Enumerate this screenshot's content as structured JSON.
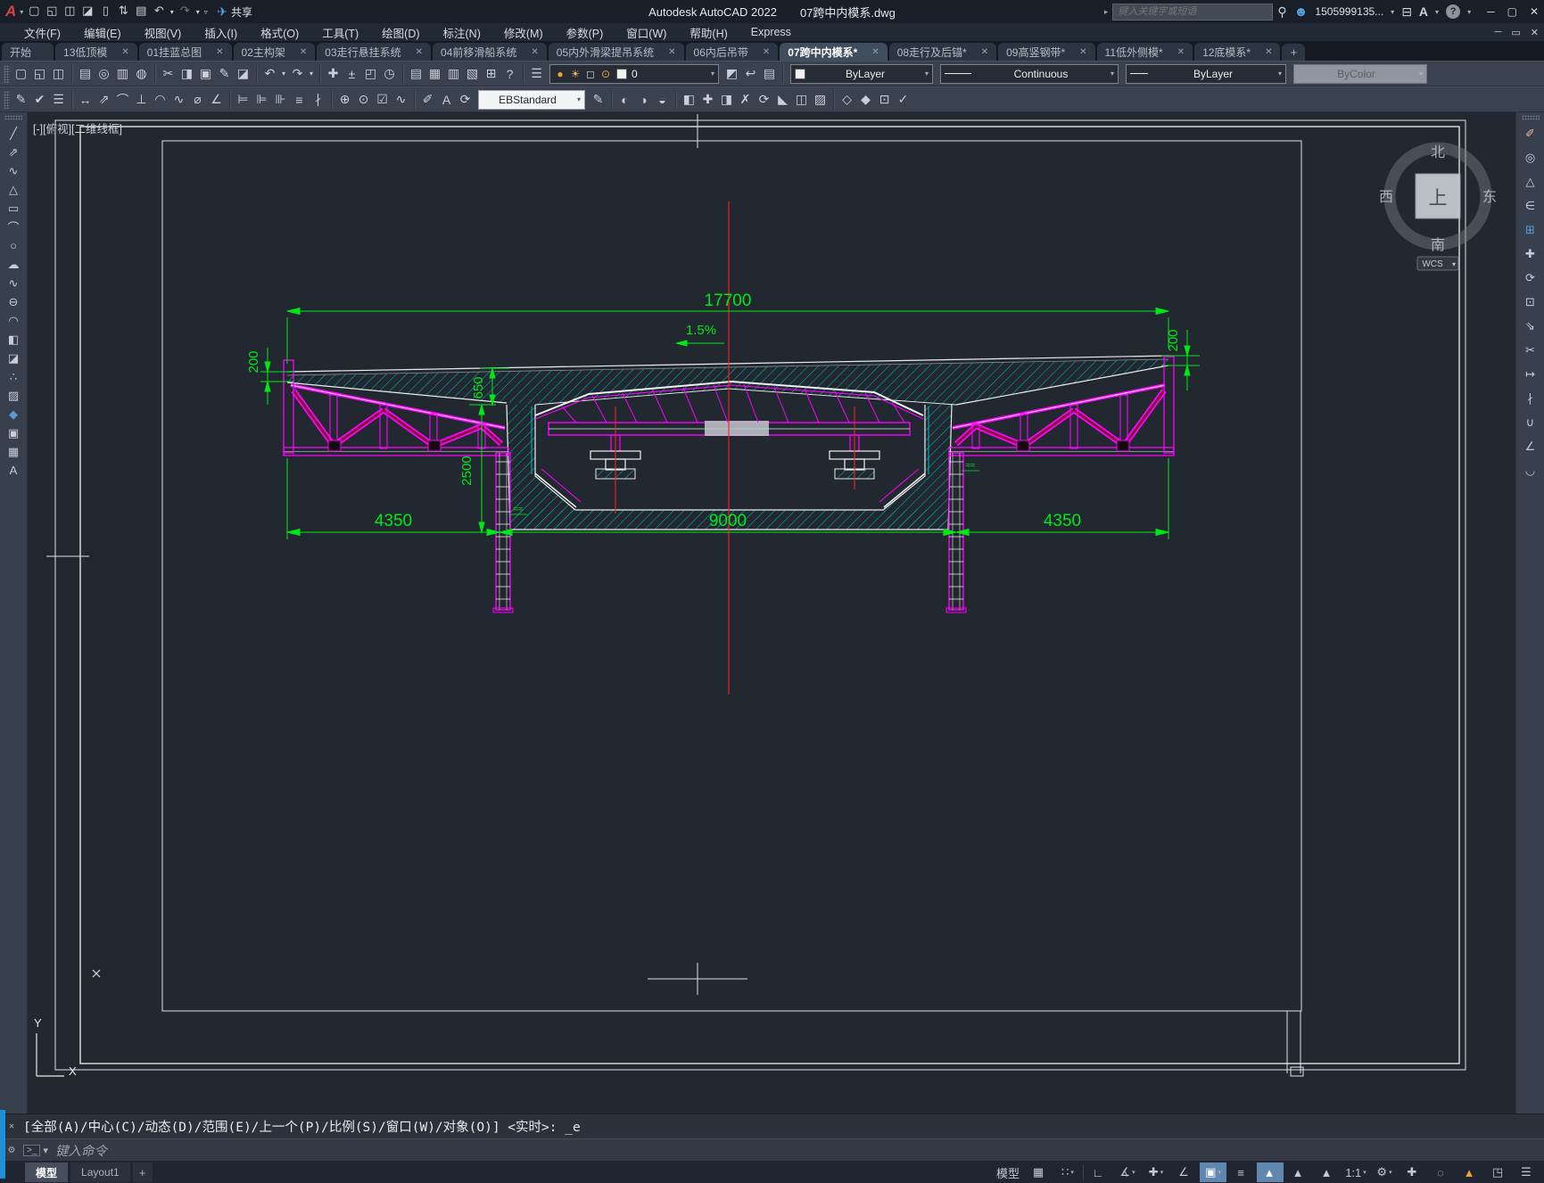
{
  "titlebar": {
    "app_title": "Autodesk AutoCAD 2022",
    "doc_title": "07跨中内模系.dwg",
    "share_label": "共享",
    "search_placeholder": "键入关键字或短语",
    "user_id": "1505999135...",
    "logo_letter": "A",
    "quick_access": [
      {
        "name": "new-file-icon",
        "g": "▢"
      },
      {
        "name": "open-file-icon",
        "g": "◱"
      },
      {
        "name": "save-icon",
        "g": "◫"
      },
      {
        "name": "save-as-icon",
        "g": "◪"
      },
      {
        "name": "save-to-mobile-icon",
        "g": "▯"
      },
      {
        "name": "open-from-mobile-icon",
        "g": "⇅"
      },
      {
        "name": "plot-icon",
        "g": "▤"
      },
      {
        "name": "undo-icon",
        "g": "↶"
      },
      {
        "name": "undo-caret-icon",
        "g": "▾",
        "small": true
      },
      {
        "name": "redo-icon",
        "g": "↷",
        "dim": true
      },
      {
        "name": "redo-caret-icon",
        "g": "▾",
        "small": true
      },
      {
        "name": "qat-customize-icon",
        "g": "▿",
        "small": true
      }
    ],
    "window_buttons": [
      {
        "name": "minimize-button",
        "g": "─"
      },
      {
        "name": "maximize-button",
        "g": "▢"
      },
      {
        "name": "close-button",
        "g": "✕"
      }
    ]
  },
  "menubar": {
    "items": [
      "文件(F)",
      "编辑(E)",
      "视图(V)",
      "插入(I)",
      "格式(O)",
      "工具(T)",
      "绘图(D)",
      "标注(N)",
      "修改(M)",
      "参数(P)",
      "窗口(W)",
      "帮助(H)",
      "Express"
    ],
    "window_buttons": [
      {
        "name": "doc-minimize-button",
        "g": "─"
      },
      {
        "name": "doc-restore-button",
        "g": "▭"
      },
      {
        "name": "doc-close-button",
        "g": "✕"
      }
    ]
  },
  "filetabs": {
    "tabs": [
      {
        "label": "开始",
        "close": ""
      },
      {
        "label": "13低顶模",
        "close": "✕"
      },
      {
        "label": "01挂蓝总图",
        "close": "✕"
      },
      {
        "label": "02主构架",
        "close": "✕"
      },
      {
        "label": "03走行悬挂系统",
        "close": "✕"
      },
      {
        "label": "04前移滑船系统",
        "close": "✕"
      },
      {
        "label": "05内外滑梁提吊系统",
        "close": "✕"
      },
      {
        "label": "06内后吊带",
        "close": "✕"
      },
      {
        "label": "07跨中内模系*",
        "close": "✕",
        "active": true
      },
      {
        "label": "08走行及后锚*",
        "close": "✕"
      },
      {
        "label": "09高竖钢带*",
        "close": "✕"
      },
      {
        "label": "11低外侧模*",
        "close": "✕"
      },
      {
        "label": "12底模系*",
        "close": "✕"
      }
    ],
    "plus_label": "+"
  },
  "toolbar1": {
    "icons": [
      {
        "name": "new-icon",
        "g": "▢"
      },
      {
        "name": "open-icon",
        "g": "◱"
      },
      {
        "name": "save-icon",
        "g": "◫"
      },
      {
        "sep": true
      },
      {
        "name": "plot-icon",
        "g": "▤"
      },
      {
        "name": "plot-preview-icon",
        "g": "◎"
      },
      {
        "name": "publish-icon",
        "g": "▥"
      },
      {
        "name": "web-icon",
        "g": "◍"
      },
      {
        "sep": true
      },
      {
        "name": "cut-icon",
        "g": "✂"
      },
      {
        "name": "copy-clip-icon",
        "g": "◨"
      },
      {
        "name": "paste-icon",
        "g": "▣"
      },
      {
        "name": "match-properties-icon",
        "g": "✎"
      },
      {
        "name": "block-editor-icon",
        "g": "◪"
      },
      {
        "sep": true
      },
      {
        "name": "undo-icon",
        "g": "↶"
      },
      {
        "name": "undo-caret-icon",
        "g": "▾",
        "small": true
      },
      {
        "name": "redo-icon",
        "g": "↷"
      },
      {
        "name": "redo-caret-icon",
        "g": "▾",
        "small": true
      },
      {
        "sep": true
      },
      {
        "name": "pan-icon",
        "g": "✚"
      },
      {
        "name": "zoom-realtime-icon",
        "g": "±"
      },
      {
        "name": "zoom-window-icon",
        "g": "◰"
      },
      {
        "name": "zoom-previous-icon",
        "g": "◷"
      },
      {
        "sep": true
      },
      {
        "name": "properties-palette-icon",
        "g": "▤"
      },
      {
        "name": "designcenter-icon",
        "g": "▦"
      },
      {
        "name": "tool-palettes-icon",
        "g": "▥"
      },
      {
        "name": "sheet-set-icon",
        "g": "▧"
      },
      {
        "name": "quickcalc-icon",
        "g": "⊞"
      },
      {
        "name": "help-icon",
        "g": "?"
      },
      {
        "sep": true
      },
      {
        "name": "layer-properties-icon",
        "g": "☰"
      }
    ],
    "layer_state_icons": [
      {
        "name": "layer-on-icon",
        "g": "●",
        "color": "#f0a23a"
      },
      {
        "name": "layer-thaw-icon",
        "g": "☀",
        "color": "#f2c24a"
      },
      {
        "name": "layer-freeze-vp-icon",
        "g": "◻",
        "color": "#c8cdd4"
      },
      {
        "name": "layer-unlock-icon",
        "g": "⊙",
        "color": "#f0a23a"
      }
    ],
    "layer_value": "0",
    "layer_tool_icons": [
      {
        "name": "make-layer-current-icon",
        "g": "◩"
      },
      {
        "name": "layer-previous-icon",
        "g": "↩"
      },
      {
        "name": "layer-states-icon",
        "g": "▤"
      }
    ],
    "color_value": "ByLayer",
    "linetype_value": "Continuous",
    "lineweight_value": "ByLayer",
    "plotstyle_value": "ByColor"
  },
  "toolbar2": {
    "icons_left": [
      {
        "name": "text-style-icon",
        "g": "✎"
      },
      {
        "name": "spell-check-icon",
        "g": "✔"
      },
      {
        "name": "styles-icon",
        "g": "☰"
      },
      {
        "sep": true
      },
      {
        "name": "dim-linear-icon",
        "g": "↔"
      },
      {
        "name": "dim-aligned-icon",
        "g": "⇗"
      },
      {
        "name": "dim-arc-icon",
        "g": "⌒"
      },
      {
        "name": "dim-ordinate-icon",
        "g": "⊥"
      },
      {
        "name": "dim-radius-icon",
        "g": "◠"
      },
      {
        "name": "dim-jogged-icon",
        "g": "∿"
      },
      {
        "name": "dim-diameter-icon",
        "g": "⌀"
      },
      {
        "name": "dim-angular-icon",
        "g": "∠"
      },
      {
        "sep": true
      },
      {
        "name": "quick-dim-icon",
        "g": "⊨"
      },
      {
        "name": "dim-baseline-icon",
        "g": "⊫"
      },
      {
        "name": "dim-continue-icon",
        "g": "⊪"
      },
      {
        "name": "dim-spacing-icon",
        "g": "≡"
      },
      {
        "name": "dim-break-icon",
        "g": "∤"
      },
      {
        "sep": true
      },
      {
        "name": "tolerance-icon",
        "g": "⊕"
      },
      {
        "name": "center-mark-icon",
        "g": "⊙"
      },
      {
        "name": "dim-inspect-icon",
        "g": "☑"
      },
      {
        "name": "dim-jog-line-icon",
        "g": "∿"
      },
      {
        "sep": true
      },
      {
        "name": "dim-edit-icon",
        "g": "✐"
      },
      {
        "name": "dim-text-edit-icon",
        "g": "A"
      },
      {
        "name": "dim-update-icon",
        "g": "⟳"
      }
    ],
    "dim_style_value": "EBStandard",
    "icons_right": [
      {
        "name": "dim-style-apply-icon",
        "g": "✎"
      },
      {
        "sep": true
      },
      {
        "name": "union-icon",
        "g": "◐"
      },
      {
        "name": "subtract-icon",
        "g": "◑"
      },
      {
        "name": "intersect-icon",
        "g": "◒"
      },
      {
        "sep": true
      },
      {
        "name": "extrude-faces-icon",
        "g": "◧"
      },
      {
        "name": "move-faces-icon",
        "g": "✚"
      },
      {
        "name": "offset-faces-icon",
        "g": "◨"
      },
      {
        "name": "delete-faces-icon",
        "g": "✗"
      },
      {
        "name": "rotate-faces-icon",
        "g": "⟳"
      },
      {
        "name": "taper-faces-icon",
        "g": "◣"
      },
      {
        "name": "copy-faces-icon",
        "g": "◫"
      },
      {
        "name": "color-faces-icon",
        "g": "▨"
      },
      {
        "sep": true
      },
      {
        "name": "color-edges-icon",
        "g": "◇"
      },
      {
        "name": "copy-edges-icon",
        "g": "◆"
      },
      {
        "name": "imprint-icon",
        "g": "⊡"
      },
      {
        "name": "clean-solid-icon",
        "g": "✓"
      }
    ]
  },
  "left_toolbar": {
    "icons": [
      {
        "name": "line-tool-icon",
        "g": "╱"
      },
      {
        "name": "construction-line-icon",
        "g": "⇗"
      },
      {
        "name": "polyline-icon",
        "g": "∿"
      },
      {
        "name": "polygon-icon",
        "g": "△"
      },
      {
        "name": "rectangle-icon",
        "g": "▭"
      },
      {
        "name": "arc-icon",
        "g": "⌒"
      },
      {
        "name": "circle-icon",
        "g": "○"
      },
      {
        "name": "revision-cloud-icon",
        "g": "☁"
      },
      {
        "name": "spline-icon",
        "g": "∿"
      },
      {
        "name": "ellipse-icon",
        "g": "⊖"
      },
      {
        "name": "ellipse-arc-icon",
        "g": "◠"
      },
      {
        "name": "insert-block-icon",
        "g": "◧"
      },
      {
        "name": "create-block-icon",
        "g": "◪"
      },
      {
        "name": "point-icon",
        "g": "∴"
      },
      {
        "name": "hatch-icon",
        "g": "▨"
      },
      {
        "name": "gradient-icon",
        "g": "◆",
        "color": "#5b9bd5"
      },
      {
        "name": "region-icon",
        "g": "▣"
      },
      {
        "name": "table-icon",
        "g": "▦"
      },
      {
        "name": "mtext-icon",
        "g": "A"
      }
    ]
  },
  "right_toolbar": {
    "icons": [
      {
        "name": "erase-icon",
        "g": "✐",
        "color": "#e8b0a0"
      },
      {
        "name": "copy-icon",
        "g": "◎"
      },
      {
        "name": "mirror-icon",
        "g": "△"
      },
      {
        "name": "offset-icon",
        "g": "∈"
      },
      {
        "name": "array-icon",
        "g": "⊞",
        "color": "#5b9bd5"
      },
      {
        "name": "move-icon",
        "g": "✚"
      },
      {
        "name": "rotate-icon",
        "g": "⟳"
      },
      {
        "name": "scale-icon",
        "g": "⊡"
      },
      {
        "name": "stretch-icon",
        "g": "⇘"
      },
      {
        "name": "trim-icon",
        "g": "✂"
      },
      {
        "name": "extend-icon",
        "g": "↦"
      },
      {
        "name": "break-icon",
        "g": "∤"
      },
      {
        "name": "join-icon",
        "g": "∪"
      },
      {
        "name": "chamfer-icon",
        "g": "∠"
      },
      {
        "name": "fillet-icon",
        "g": "◡"
      }
    ]
  },
  "canvas": {
    "viewport_label": "[-][俯视][二维线框]",
    "viewcube": {
      "north": "北",
      "south": "南",
      "west": "西",
      "east": "东",
      "top": "上",
      "wcs": "WCS",
      "wcs_caret": "▾"
    },
    "ucs": {
      "x_label": "X",
      "y_label": "Y"
    }
  },
  "drawing": {
    "dims": {
      "total_width": "17700",
      "slope": "1.5%",
      "left_edge": "200",
      "right_edge": "200",
      "haunch": "650",
      "depth": "2500",
      "span_left": "4350",
      "span_mid": "9000",
      "span_right": "4350"
    },
    "annotations": {
      "left_mark": "≈≈",
      "right_mark": "≈≈"
    }
  },
  "commandline": {
    "history_line": "[全部(A)/中心(C)/动态(D)/范围(E)/上一个(P)/比例(S)/窗口(W)/对象(O)] <实时>: _e",
    "close_glyph": "✕",
    "wrench_glyph": "⚙",
    "prompt_glyph": ">_",
    "prompt_caret": "▾",
    "input_placeholder": "键入命令"
  },
  "bottombar": {
    "layout_tabs": [
      {
        "label": "模型",
        "active": true
      },
      {
        "label": "Layout1"
      }
    ],
    "plus_label": "+",
    "status_icons": [
      {
        "name": "model-paper-toggle",
        "g": "模型",
        "text": true
      },
      {
        "name": "grid-display-icon",
        "g": "▦"
      },
      {
        "name": "snap-mode-icon",
        "g": "∷",
        "caret": "▾"
      },
      {
        "sep": true
      },
      {
        "name": "ortho-mode-icon",
        "g": "∟"
      },
      {
        "name": "polar-tracking-icon",
        "g": "∡",
        "caret": "▾"
      },
      {
        "name": "isodraft-icon",
        "g": "✚",
        "caret": "▾"
      },
      {
        "name": "object-snap-tracking-icon",
        "g": "∠"
      },
      {
        "name": "object-snap-icon",
        "g": "▣",
        "caret": "▾",
        "active": true
      },
      {
        "name": "lineweight-display-icon",
        "g": "≡"
      },
      {
        "name": "annotation-visibility-icon",
        "g": "▲",
        "active": true
      },
      {
        "name": "annotation-autoscale-icon",
        "g": "▲"
      },
      {
        "name": "annotation-scale-icon",
        "g": "▲"
      },
      {
        "name": "annotation-scale-value",
        "g": "1:1",
        "text": true,
        "caret": "▾"
      },
      {
        "name": "workspace-switching-icon",
        "g": "⚙",
        "caret": "▾"
      },
      {
        "name": "annotation-monitor-icon",
        "g": "✚"
      },
      {
        "name": "isolate-objects-icon",
        "g": "◌"
      },
      {
        "name": "graphics-performance-icon",
        "g": "▲",
        "color": "#e8a33c"
      },
      {
        "name": "clean-screen-icon",
        "g": "◳"
      },
      {
        "name": "customize-icon",
        "g": "☰"
      }
    ]
  }
}
